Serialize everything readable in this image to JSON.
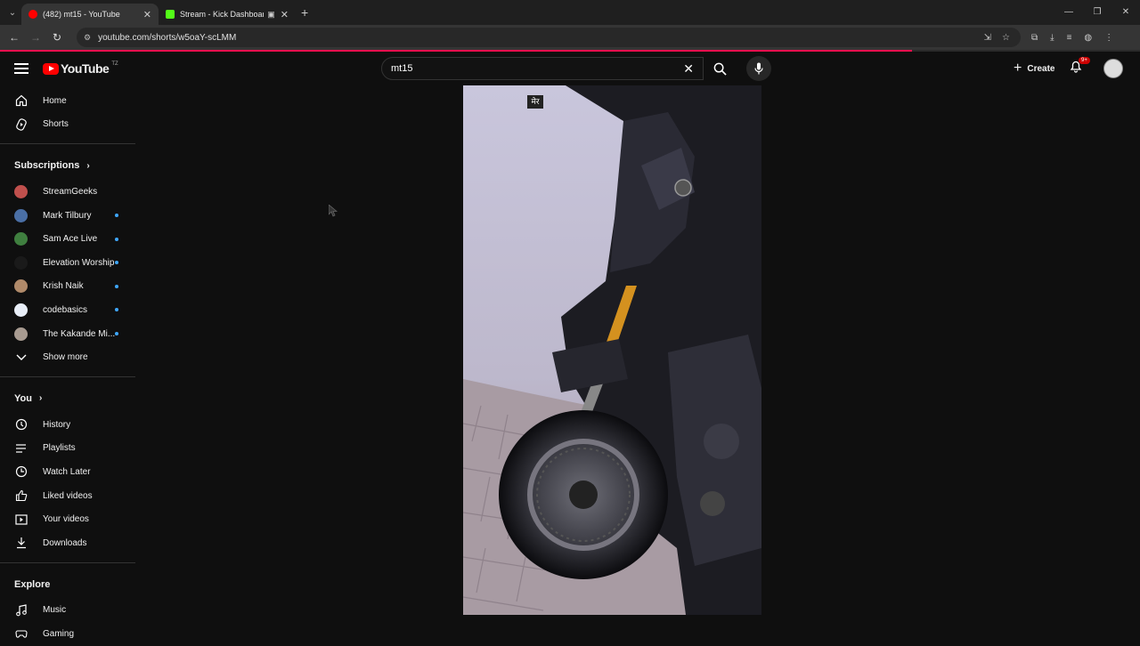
{
  "browser": {
    "tabs": [
      {
        "title": "(482) mt15 - YouTube",
        "active": true,
        "favicon_color": "#ff0000"
      },
      {
        "title": "Stream - Kick Dashboard",
        "active": false,
        "favicon_color": "#53fc18"
      }
    ],
    "url": "youtube.com/shorts/w5oaY-scLMM",
    "load_progress_pct": 80
  },
  "header": {
    "logo_text": "YouTube",
    "country_code": "TZ",
    "search_value": "mt15",
    "create_label": "Create",
    "notif_badge": "9+"
  },
  "sidebar": {
    "main": [
      {
        "label": "Home",
        "icon": "home-icon"
      },
      {
        "label": "Shorts",
        "icon": "shorts-icon"
      }
    ],
    "subscriptions_title": "Subscriptions",
    "subscriptions": [
      {
        "label": "StreamGeeks",
        "color": "#c0504d",
        "dot": false
      },
      {
        "label": "Mark Tilbury",
        "color": "#4a6fa5",
        "dot": true
      },
      {
        "label": "Sam Ace Live",
        "color": "#3f7f3f",
        "dot": true
      },
      {
        "label": "Elevation Worship",
        "color": "#1a1a1a",
        "dot": true
      },
      {
        "label": "Krish Naik",
        "color": "#b08a6a",
        "dot": true
      },
      {
        "label": "codebasics",
        "color": "#e8eef7",
        "dot": true
      },
      {
        "label": "The Kakande Mi...",
        "color": "#a79a90",
        "dot": true
      }
    ],
    "show_more": "Show more",
    "you_title": "You",
    "you": [
      {
        "label": "History",
        "icon": "history-icon"
      },
      {
        "label": "Playlists",
        "icon": "playlists-icon"
      },
      {
        "label": "Watch Later",
        "icon": "watch-later-icon"
      },
      {
        "label": "Liked videos",
        "icon": "like-icon"
      },
      {
        "label": "Your videos",
        "icon": "your-videos-icon"
      },
      {
        "label": "Downloads",
        "icon": "download-icon"
      }
    ],
    "explore_title": "Explore",
    "explore": [
      {
        "label": "Music",
        "icon": "music-icon"
      },
      {
        "label": "Gaming",
        "icon": "gaming-icon"
      }
    ]
  },
  "video": {
    "watermark": "मेर"
  }
}
